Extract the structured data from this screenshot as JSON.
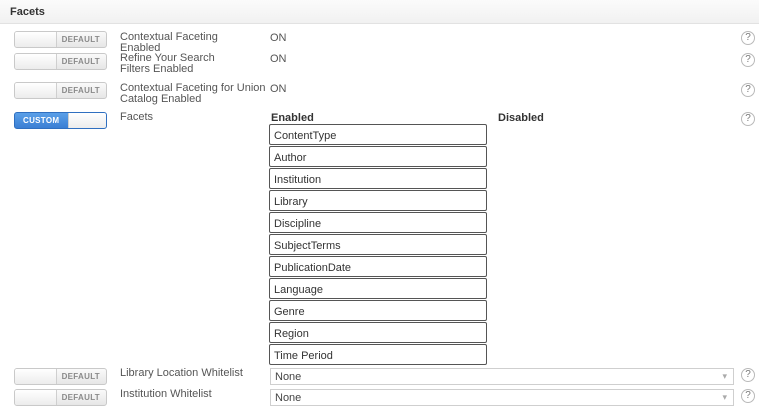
{
  "section": {
    "title": "Facets"
  },
  "rows": [
    {
      "toggle": "DEFAULT",
      "label": "Contextual Faceting Enabled",
      "value": "ON",
      "help": "?"
    },
    {
      "toggle": "DEFAULT",
      "label": "Refine Your Search Filters Enabled",
      "value": "ON",
      "help": "?"
    },
    {
      "toggle": "DEFAULT",
      "label": "Contextual Faceting for Union Catalog Enabled",
      "value": "ON",
      "help": "?"
    }
  ],
  "facets": {
    "toggle": "CUSTOM",
    "label": "Facets",
    "help": "?",
    "enabled_heading": "Enabled",
    "disabled_heading": "Disabled",
    "enabled": [
      "ContentType",
      "Author",
      "Institution",
      "Library",
      "Discipline",
      "SubjectTerms",
      "PublicationDate",
      "Language",
      "Genre",
      "Region",
      "Time Period"
    ],
    "disabled": []
  },
  "whitelists": [
    {
      "toggle": "DEFAULT",
      "label": "Library Location Whitelist",
      "value": "None",
      "help": "?"
    },
    {
      "toggle": "DEFAULT",
      "label": "Institution Whitelist",
      "value": "None",
      "help": "?"
    }
  ]
}
